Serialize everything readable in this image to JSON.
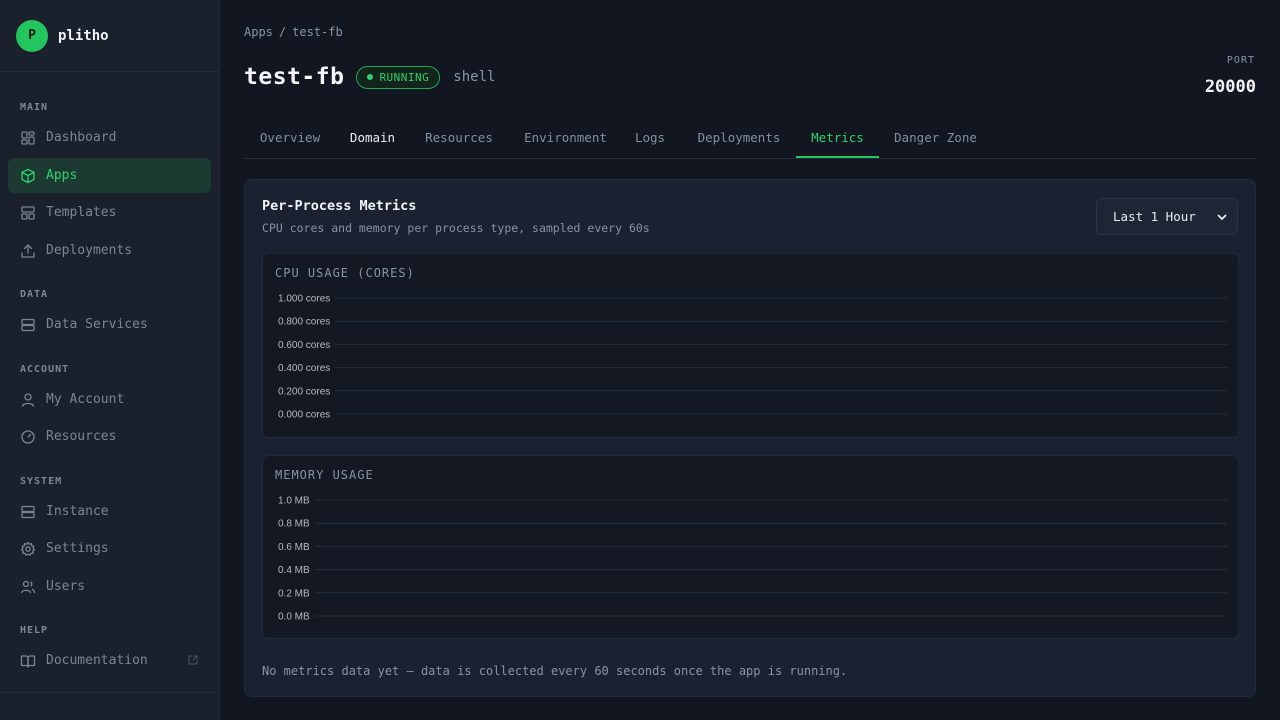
{
  "sidebar": {
    "brand_initial": "P",
    "brand_name": "plitho",
    "sections": {
      "main": "MAIN",
      "data": "DATA",
      "account": "ACCOUNT",
      "system": "SYSTEM",
      "help": "HELP"
    },
    "items": {
      "dashboard": "Dashboard",
      "apps": "Apps",
      "templates": "Templates",
      "deployments": "Deployments",
      "data_services": "Data Services",
      "my_account": "My Account",
      "resources": "Resources",
      "instance": "Instance",
      "settings": "Settings",
      "users": "Users",
      "documentation": "Documentation"
    },
    "active_item": "Apps"
  },
  "breadcrumb": {
    "root": "Apps",
    "separator": "/",
    "current": "test-fb"
  },
  "app": {
    "name": "test-fb",
    "status": "RUNNING",
    "type": "shell",
    "port_label": "PORT",
    "port": "20000"
  },
  "tabs": {
    "overview": "Overview",
    "domain": "Domain",
    "resources": "Resources",
    "environment": "Environment",
    "logs": "Logs",
    "deployments": "Deployments",
    "metrics": "Metrics",
    "danger_zone": "Danger Zone",
    "active": "Metrics"
  },
  "metrics": {
    "title": "Per-Process Metrics",
    "subtitle": "CPU cores and memory per process type, sampled every 60s",
    "range": "Last 1 Hour",
    "empty_message": "No metrics data yet — data is collected every 60 seconds once the app is running."
  },
  "colors": {
    "accent": "#22c55e",
    "background": "#111621",
    "sidebar": "#1a202c",
    "card": "#1a2130"
  },
  "chart_data": [
    {
      "type": "line",
      "title": "CPU USAGE (CORES)",
      "y_ticks": [
        "1.000 cores",
        "0.800 cores",
        "0.600 cores",
        "0.400 cores",
        "0.200 cores",
        "0.000 cores"
      ],
      "ylim": [
        0,
        1
      ],
      "series": [],
      "grid": true
    },
    {
      "type": "line",
      "title": "MEMORY USAGE",
      "y_ticks": [
        "1.0 MB",
        "0.8 MB",
        "0.6 MB",
        "0.4 MB",
        "0.2 MB",
        "0.0 MB"
      ],
      "ylim": [
        0,
        1
      ],
      "series": [],
      "grid": true
    }
  ]
}
